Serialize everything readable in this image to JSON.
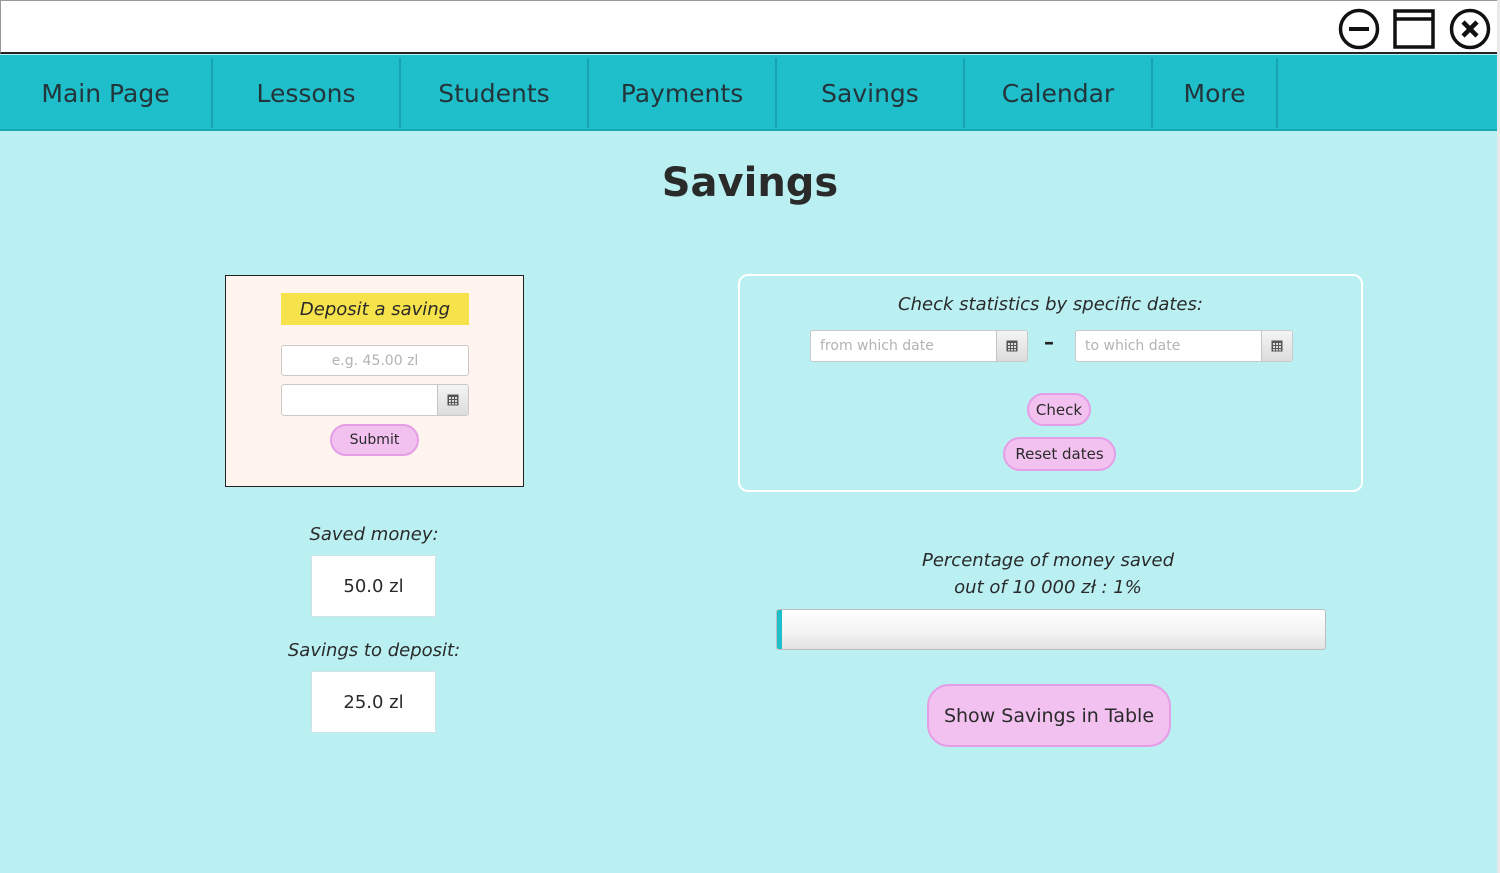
{
  "window_controls": {
    "minimize_icon": "minus-circle-icon",
    "maximize_icon": "window-maximize-icon",
    "close_icon": "close-circle-icon"
  },
  "nav": {
    "items": [
      {
        "label": "Main Page"
      },
      {
        "label": "Lessons"
      },
      {
        "label": "Students"
      },
      {
        "label": "Payments"
      },
      {
        "label": "Savings"
      },
      {
        "label": "Calendar"
      },
      {
        "label": "More"
      }
    ]
  },
  "page": {
    "title": "Savings"
  },
  "deposit": {
    "header": "Deposit a saving",
    "amount_placeholder": "e.g. 45.00 zl",
    "amount_value": "",
    "date_value": "",
    "submit_label": "Submit"
  },
  "summary": {
    "saved_label": "Saved money:",
    "saved_value": "50.0 zl",
    "to_deposit_label": "Savings to deposit:",
    "to_deposit_value": "25.0 zl"
  },
  "stats": {
    "title": "Check statistics by specific dates:",
    "from_placeholder": "from which date",
    "to_placeholder": "to which date",
    "separator": "–",
    "check_label": "Check",
    "reset_label": "Reset dates"
  },
  "progress": {
    "line1": "Percentage of money saved",
    "line2": "out of 10 000 zł : 1%",
    "percent": 1
  },
  "actions": {
    "show_table_label": "Show Savings in Table"
  },
  "colors": {
    "background": "#bbf0f3",
    "navbar": "#1fbecb",
    "pill_button": "#f2c1f0",
    "deposit_header": "#f6e24a",
    "deposit_panel": "#fff4ee"
  }
}
